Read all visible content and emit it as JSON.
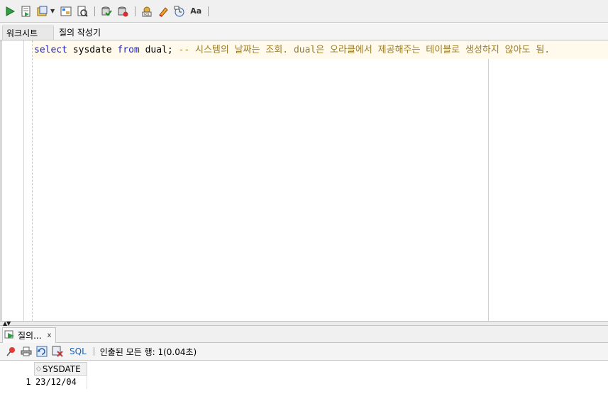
{
  "toolbar": {
    "buttons": [
      {
        "icon": "run-statement-icon"
      },
      {
        "icon": "run-script-icon"
      },
      {
        "icon": "autotrace-icon"
      },
      {
        "icon": "explain-plan-icon"
      },
      {
        "icon": "sql-tuning-icon"
      },
      {
        "icon": "commit-icon"
      },
      {
        "icon": "rollback-icon"
      },
      {
        "icon": "unshared-sql-icon"
      },
      {
        "icon": "clear-icon"
      },
      {
        "icon": "history-icon"
      },
      {
        "icon": "format-case-icon"
      }
    ],
    "format_label": "Aa"
  },
  "tabs": [
    {
      "label": "워크시트",
      "active": true
    },
    {
      "label": "질의 작성기",
      "active": false
    }
  ],
  "editor": {
    "keyword_select": "select",
    "ident_sysdate": "sysdate",
    "keyword_from": "from",
    "ident_dual": "dual;",
    "comment": "-- 시스템의 날짜는 조회. dual은 오라클에서 제공해주는 테이블로 생성하지 않아도 됨."
  },
  "result": {
    "tab_label": "질의...",
    "close_glyph": "x",
    "sql_label": "SQL",
    "status_text": "인출된 모든 행: 1(0.04초)",
    "columns": [
      "SYSDATE"
    ],
    "rows": [
      {
        "num": "1",
        "cells": [
          "23/12/04"
        ]
      }
    ]
  },
  "colors": {
    "keyword": "#2222cc",
    "comment": "#9a7d2e",
    "current_line": "#fffaeb"
  }
}
